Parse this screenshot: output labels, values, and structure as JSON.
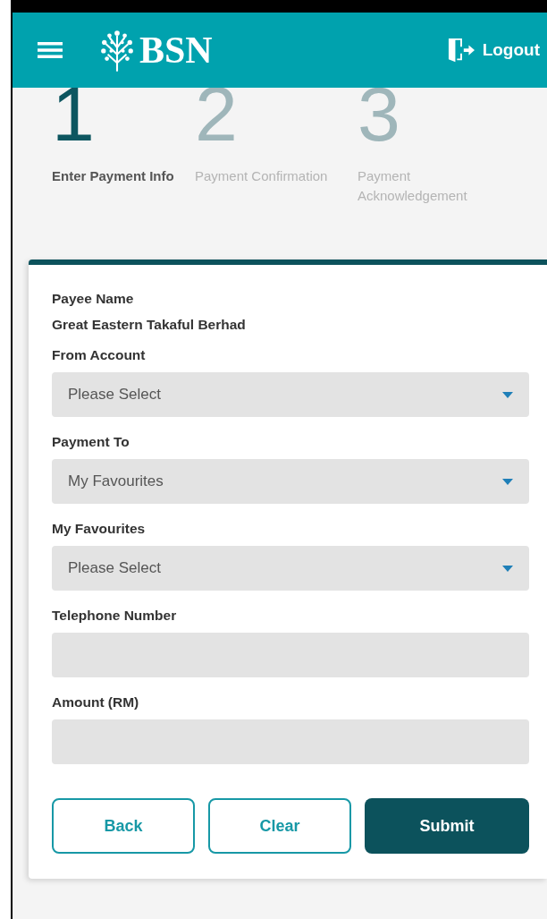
{
  "header": {
    "brand": "BSN",
    "logout": "Logout"
  },
  "steps": [
    {
      "number": "1",
      "label": "Enter Payment Info",
      "selected": true
    },
    {
      "number": "2",
      "label": "Payment Confirmation",
      "selected": false
    },
    {
      "number": "3",
      "label": "Payment Acknowledgement",
      "selected": false
    }
  ],
  "payee": {
    "label": "Payee Name",
    "value": "Great Eastern Takaful Berhad"
  },
  "fields": [
    {
      "label": "From Account",
      "kind": "select",
      "value": "Please Select"
    },
    {
      "label": "Payment To",
      "kind": "select",
      "value": "My Favourites"
    },
    {
      "label": "My Favourites",
      "kind": "select",
      "value": "Please Select"
    },
    {
      "label": "Telephone Number",
      "kind": "text"
    },
    {
      "label": "Amount (RM)",
      "kind": "text"
    }
  ],
  "buttons": [
    {
      "label": "Back",
      "kind": "outline"
    },
    {
      "label": "Clear",
      "kind": "outline"
    },
    {
      "label": "Submit",
      "kind": "primary"
    }
  ]
}
